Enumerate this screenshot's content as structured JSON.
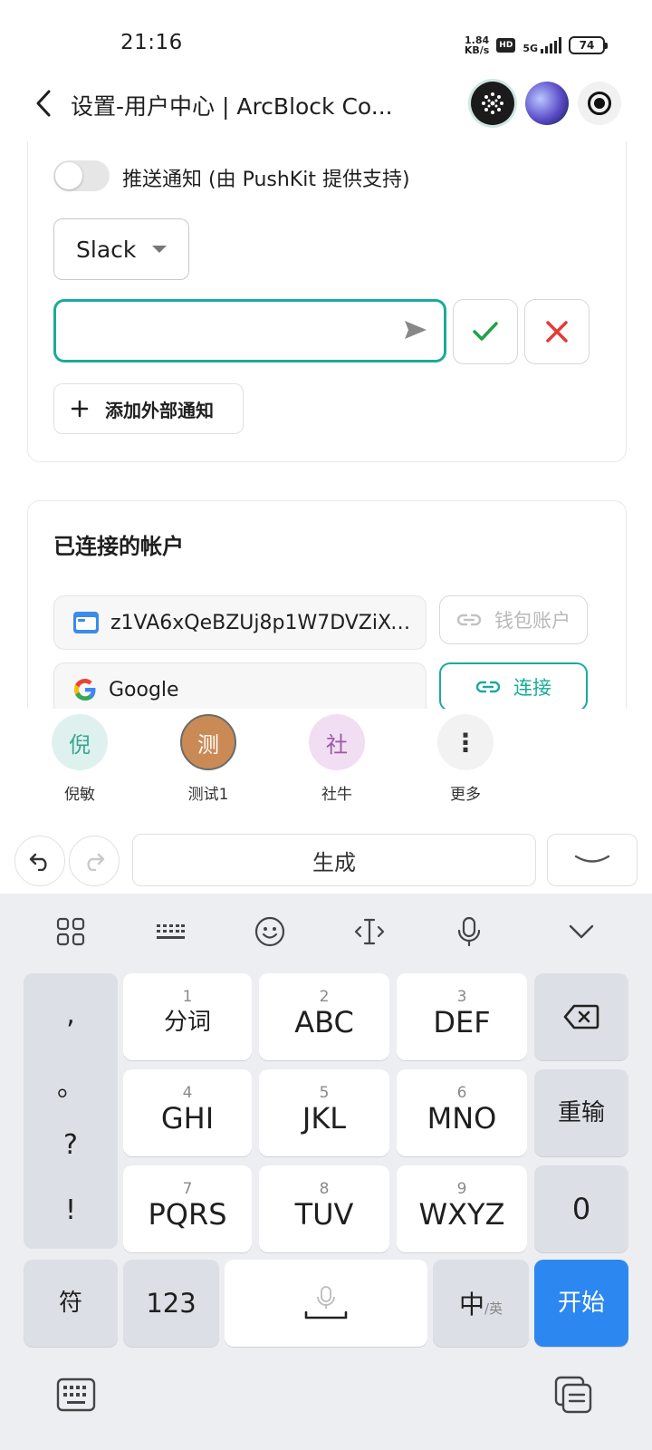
{
  "status_bar": {
    "time": "21:16",
    "net_speed_value": "1.84",
    "net_speed_unit": "KB/s",
    "hd_badge": "HD",
    "network": "5G",
    "battery": "74"
  },
  "header": {
    "title": "设置-用户中心 | ArcBlock Co..."
  },
  "notifications": {
    "push_label": "推送通知 (由 PushKit 提供支持)",
    "channel_select": "Slack",
    "url_input_value": "",
    "add_external_label": "添加外部通知"
  },
  "connected_accounts": {
    "title": "已连接的帐户",
    "wallet_address": "z1VA6xQeBZUj8p1W7DVZiXe...",
    "wallet_button": "钱包账户",
    "google_label": "Google",
    "connect_button": "连接"
  },
  "contacts": [
    {
      "avatar_text": "倪",
      "name": "倪敏",
      "bg": "#dff1ee",
      "fg": "#3aa597"
    },
    {
      "avatar_text": "测",
      "name": "测试1",
      "bg": "#c98a56",
      "fg": "#ffffff"
    },
    {
      "avatar_text": "社",
      "name": "社牛",
      "bg": "#f1def3",
      "fg": "#9a58a6"
    },
    {
      "avatar_text": "⋮",
      "name": "更多",
      "bg": "#f2f2f2",
      "fg": "#333333"
    }
  ],
  "candidate_bar": {
    "generate_label": "生成"
  },
  "keyboard": {
    "punctuation": [
      ",",
      "。",
      "?",
      "!"
    ],
    "keys": [
      {
        "num": "1",
        "label": "分词"
      },
      {
        "num": "2",
        "label": "ABC"
      },
      {
        "num": "3",
        "label": "DEF"
      },
      {
        "num": "4",
        "label": "GHI"
      },
      {
        "num": "5",
        "label": "JKL"
      },
      {
        "num": "6",
        "label": "MNO"
      },
      {
        "num": "7",
        "label": "PQRS"
      },
      {
        "num": "8",
        "label": "TUV"
      },
      {
        "num": "9",
        "label": "WXYZ"
      }
    ],
    "reinput_label": "重输",
    "zero_label": "0",
    "symbol_label": "符",
    "num_label": "123",
    "lang_label_main": "中",
    "lang_label_sub": "/英",
    "start_label": "开始"
  },
  "colors": {
    "accent": "#1aab9b",
    "cancel_red": "#e53935",
    "start_blue": "#2d87f0"
  }
}
